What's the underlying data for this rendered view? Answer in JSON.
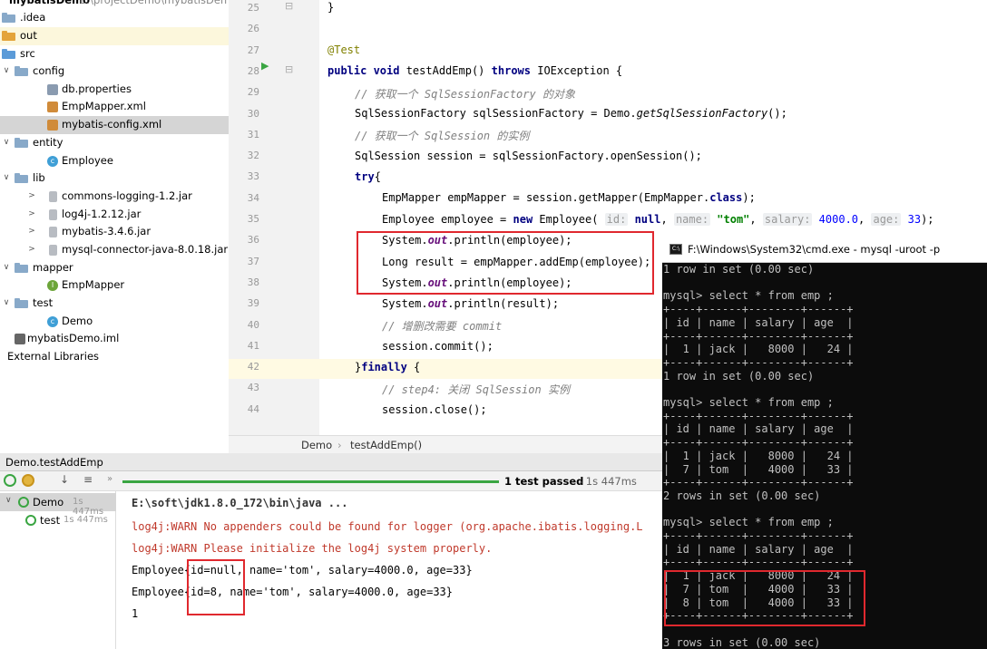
{
  "project_tree": {
    "root_label": "mybatisDemo",
    "root_path": "E:\\projectDemo\\mybatisDem",
    "items": [
      {
        "label": ".idea",
        "kind": "folder"
      },
      {
        "label": "out",
        "kind": "folder-orange"
      },
      {
        "label": "src",
        "kind": "folder-blue"
      },
      {
        "label": "config",
        "kind": "folder"
      },
      {
        "label": "db.properties",
        "kind": "properties"
      },
      {
        "label": "EmpMapper.xml",
        "kind": "xml"
      },
      {
        "label": "mybatis-config.xml",
        "kind": "xml"
      },
      {
        "label": "entity",
        "kind": "folder"
      },
      {
        "label": "Employee",
        "kind": "class"
      },
      {
        "label": "lib",
        "kind": "folder"
      },
      {
        "label": "commons-logging-1.2.jar",
        "kind": "jar"
      },
      {
        "label": "log4j-1.2.12.jar",
        "kind": "jar"
      },
      {
        "label": "mybatis-3.4.6.jar",
        "kind": "jar"
      },
      {
        "label": "mysql-connector-java-8.0.18.jar",
        "kind": "jar"
      },
      {
        "label": "mapper",
        "kind": "folder"
      },
      {
        "label": "EmpMapper",
        "kind": "interface"
      },
      {
        "label": "test",
        "kind": "folder"
      },
      {
        "label": "Demo",
        "kind": "class"
      },
      {
        "label": "mybatisDemo.iml",
        "kind": "iml"
      },
      {
        "label": "External Libraries",
        "kind": "libs"
      }
    ]
  },
  "editor": {
    "line_numbers": [
      "25",
      "26",
      "27",
      "28",
      "29",
      "30",
      "31",
      "32",
      "33",
      "34",
      "35",
      "36",
      "37",
      "38",
      "39",
      "40",
      "41",
      "42",
      "43",
      "44"
    ],
    "lines": {
      "l25": "}",
      "l27": "@Test",
      "l28_kw1": "public void",
      "l28_rest": " testAddEmp() ",
      "l28_kw2": "throws",
      "l28_end": " IOException {",
      "l29": "// 获取一个 SqlSessionFactory 的对象",
      "l30_a": "SqlSessionFactory sqlSessionFactory = Demo.",
      "l30_b": "getSqlSessionFactory",
      "l30_c": "();",
      "l31": "// 获取一个 SqlSession 的实例",
      "l32": "SqlSession session = sqlSessionFactory.openSession();",
      "l33_kw": "try",
      "l33_rest": "{",
      "l34_a": "EmpMapper empMapper = session.getMapper(EmpMapper.",
      "l34_kw": "class",
      "l34_c": ");",
      "l35_a": "Employee employee = ",
      "l35_kw": "new",
      "l35_b": " Employee( ",
      "l35_h1": "id:",
      "l35_v1": " null",
      "l35_h2": "name:",
      "l35_v2": " \"tom\"",
      "l35_h3": "salary:",
      "l35_v3": " 4000.0",
      "l35_h4": "age:",
      "l35_v4": " 33",
      "l35_end": ");",
      "l36_a": "System.",
      "l36_f": "out",
      "l36_b": ".println(employee);",
      "l37": "Long result = empMapper.addEmp(employee);",
      "l38_a": "System.",
      "l38_f": "out",
      "l38_b": ".println(employee);",
      "l39_a": "System.",
      "l39_f": "out",
      "l39_b": ".println(result);",
      "l40": "// 增删改需要 commit",
      "l41": "session.commit();",
      "l42_a": "}",
      "l42_kw": "finally",
      "l42_b": " {",
      "l43": "// step4: 关闭 SqlSession 实例",
      "l44": "session.close();"
    }
  },
  "breadcrumb": {
    "class": "Demo",
    "method": "testAddEmp()"
  },
  "run_panel": {
    "tab_title": "Demo.testAddEmp",
    "status": "1 test passed",
    "status_time": " - 1s 447ms",
    "tree": [
      {
        "label": "Demo",
        "time": "1s 447ms"
      },
      {
        "label": "test",
        "time": "1s 447ms"
      }
    ],
    "console": [
      "E:\\soft\\jdk1.8.0_172\\bin\\java ...",
      "log4j:WARN No appenders could be found for logger (org.apache.ibatis.logging.L",
      "log4j:WARN Please initialize the log4j system properly.",
      "Employee{id=null, name='tom', salary=4000.0, age=33}",
      "Employee{id=8, name='tom', salary=4000.0, age=33}",
      "1"
    ]
  },
  "cmd": {
    "title": "F:\\Windows\\System32\\cmd.exe - mysql  -uroot -p",
    "lines": [
      "1 row in set (0.00 sec)",
      "",
      "mysql> select * from emp ;",
      "+----+------+--------+------+",
      "| id | name | salary | age  |",
      "+----+------+--------+------+",
      "|  1 | jack |   8000 |   24 |",
      "+----+------+--------+------+",
      "1 row in set (0.00 sec)",
      "",
      "mysql> select * from emp ;",
      "+----+------+--------+------+",
      "| id | name | salary | age  |",
      "+----+------+--------+------+",
      "|  1 | jack |   8000 |   24 |",
      "|  7 | tom  |   4000 |   33 |",
      "+----+------+--------+------+",
      "2 rows in set (0.00 sec)",
      "",
      "mysql> select * from emp ;",
      "+----+------+--------+------+",
      "| id | name | salary | age  |",
      "+----+------+--------+------+",
      "|  1 | jack |   8000 |   24 |",
      "|  7 | tom  |   4000 |   33 |",
      "|  8 | tom  |   4000 |   33 |",
      "+----+------+--------+------+",
      "",
      "3 rows in set (0.00 sec)"
    ]
  }
}
